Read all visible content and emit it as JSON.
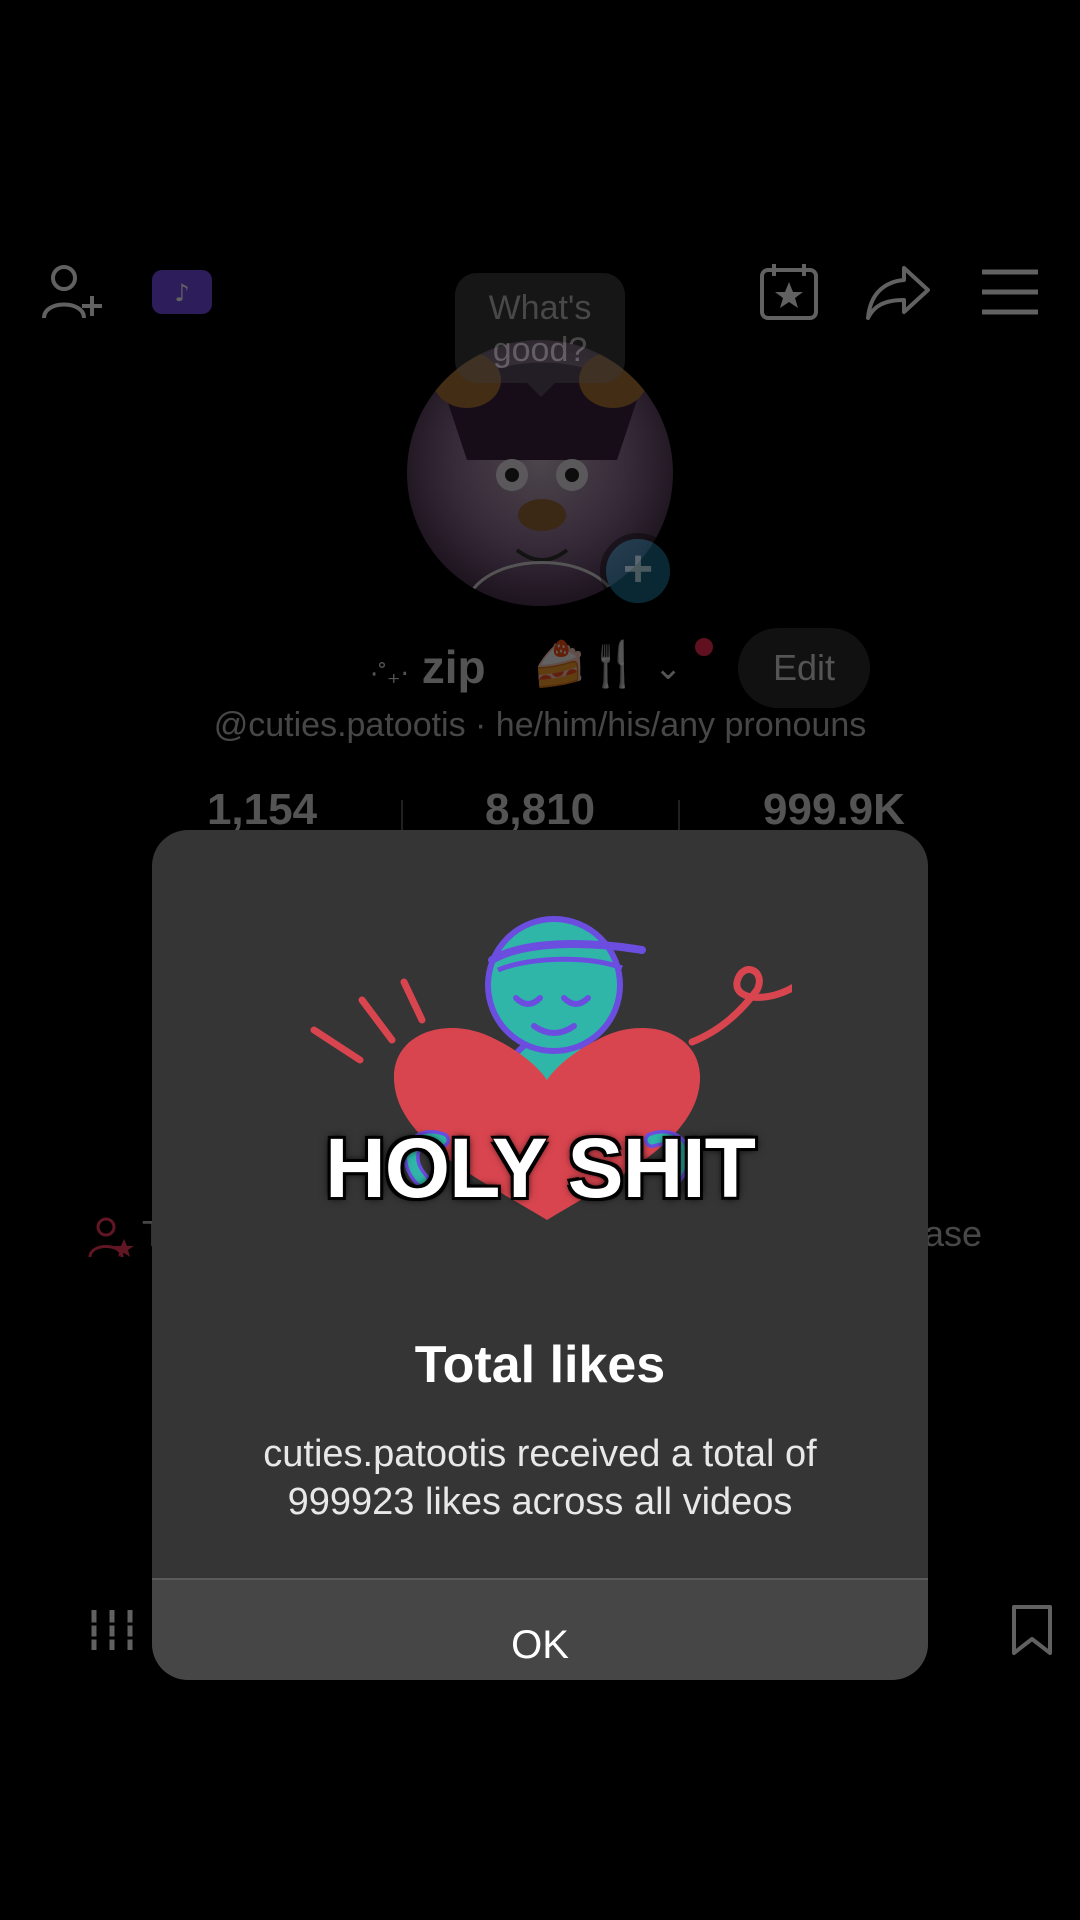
{
  "tooltip": {
    "text": "What's good?"
  },
  "profile": {
    "display_name": "zip",
    "name_prefix": "⋅˚₊‧",
    "name_emoji": "🍰🍴",
    "edit_label": "Edit",
    "handle": "@cuties.patootis · he/him/his/any pronouns",
    "stats": {
      "following": "1,154",
      "followers": "8,810",
      "likes": "999.9K"
    },
    "side_left": "T",
    "side_right": "ase"
  },
  "icons": [
    "add-friend-icon",
    "tiktok-badge-icon",
    "calendar-star-icon",
    "share-icon",
    "menu-icon",
    "add-avatar-icon",
    "dropdown-chevron-icon",
    "creator-star-icon",
    "grid-icon",
    "bookmark-icon"
  ],
  "modal": {
    "title": "Total likes",
    "message": "cuties.patootis received a total of 999923 likes across all videos",
    "ok_label": "OK"
  },
  "overlay_caption": "HOLY SHIT",
  "colors": {
    "modal_bg": "#353535",
    "heart": "#d9454f",
    "figure": "#2fb6a9",
    "accent_purple": "#6b4ee0"
  }
}
